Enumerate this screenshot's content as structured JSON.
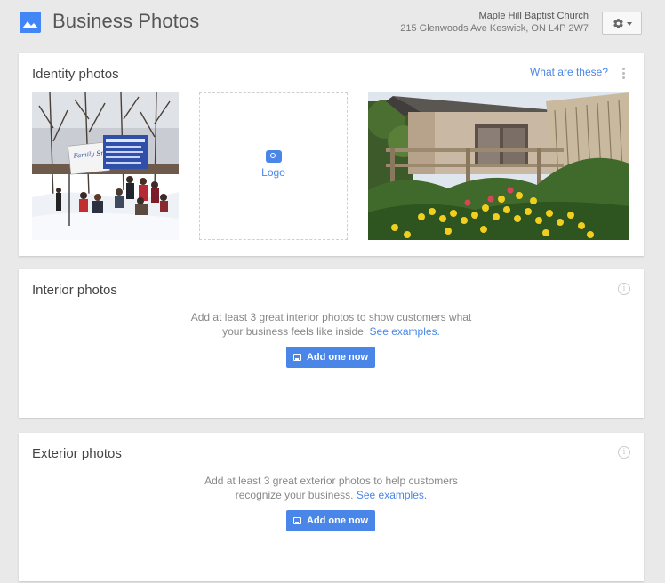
{
  "header": {
    "title": "Business Photos",
    "business_name": "Maple Hill Baptist Church",
    "business_address": "215 Glenwoods Ave Keswick, ON L4P 2W7",
    "app_icon": "photos-mountain-icon",
    "settings_icon": "gear-icon"
  },
  "identity": {
    "title": "Identity photos",
    "help_link": "What are these?",
    "cover_photo_sign": "Family Snow Day",
    "logo_label": "Logo"
  },
  "interior": {
    "title": "Interior photos",
    "line1": "Add at least 3 great interior photos to show customers what",
    "line2": "your business feels like inside.",
    "link": "See examples.",
    "button": "Add one now"
  },
  "exterior": {
    "title": "Exterior photos",
    "line1": "Add at least 3 great exterior photos to help customers",
    "line2": "recognize your business.",
    "link": "See examples.",
    "button": "Add one now"
  },
  "colors": {
    "accent": "#4a86e8",
    "background": "#e9e9e9",
    "card": "#ffffff"
  }
}
